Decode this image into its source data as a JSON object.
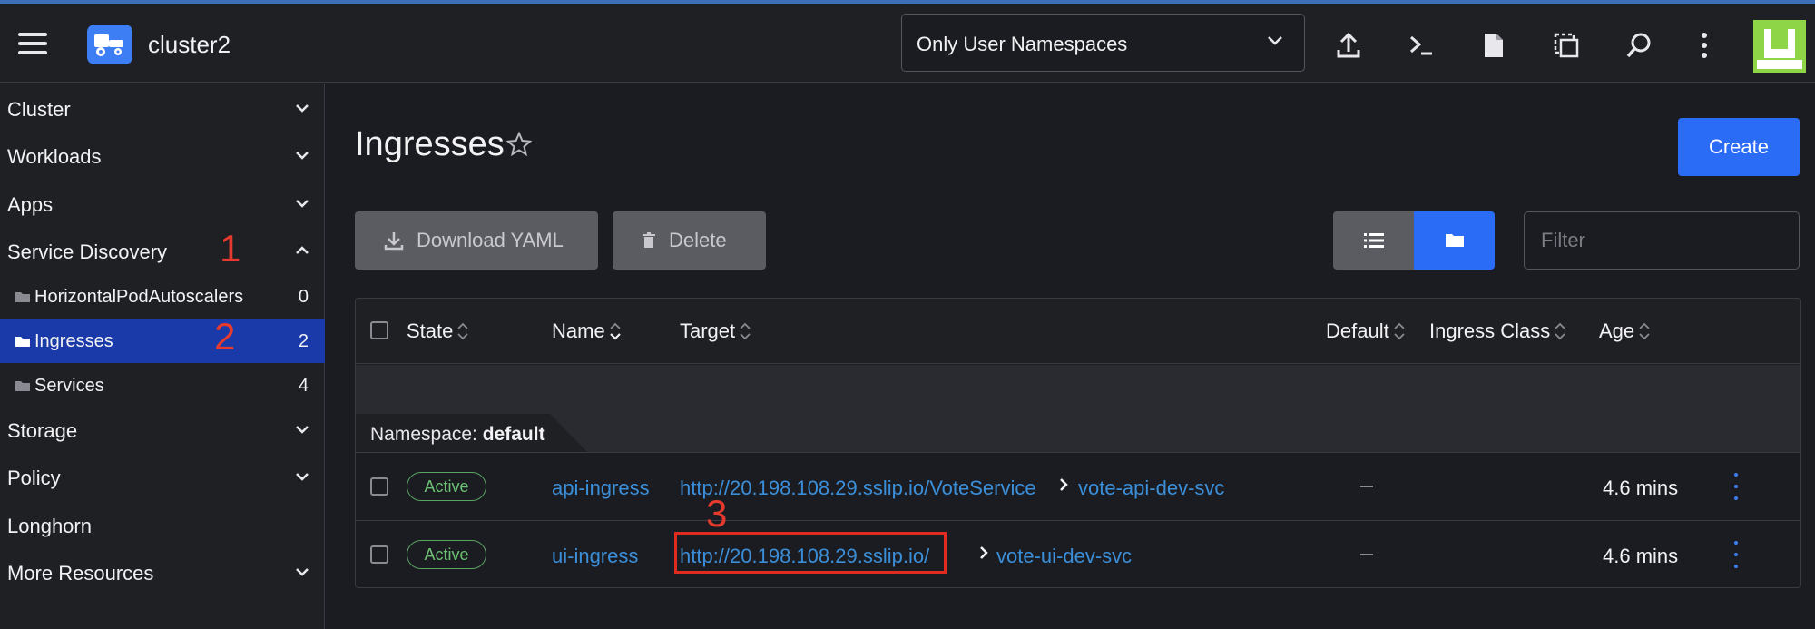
{
  "header": {
    "cluster_name": "cluster2",
    "namespace_filter": "Only User Namespaces",
    "icons": [
      "upload-icon",
      "terminal-icon",
      "file-icon",
      "copy-config-icon",
      "search-icon",
      "more-vertical-icon"
    ]
  },
  "sidebar": {
    "groups": [
      {
        "label": "Cluster"
      },
      {
        "label": "Workloads"
      },
      {
        "label": "Apps"
      },
      {
        "label": "Service Discovery"
      },
      {
        "label": "Storage"
      },
      {
        "label": "Policy"
      },
      {
        "label": "Longhorn"
      },
      {
        "label": "More Resources"
      }
    ],
    "items": [
      {
        "label": "HorizontalPodAutoscalers",
        "count": "0"
      },
      {
        "label": "Ingresses",
        "count": "2"
      },
      {
        "label": "Services",
        "count": "4"
      }
    ]
  },
  "annotations": {
    "one": "1",
    "two": "2",
    "three": "3"
  },
  "main": {
    "title": "Ingresses",
    "create_label": "Create",
    "download_label": "Download YAML",
    "delete_label": "Delete",
    "filter_placeholder": "Filter"
  },
  "table": {
    "columns": [
      "State",
      "Name",
      "Target",
      "Default",
      "Ingress Class",
      "Age"
    ],
    "group_prefix": "Namespace:",
    "group_name": "default",
    "rows": [
      {
        "state": "Active",
        "name": "api-ingress",
        "target_url": "http://20.198.108.29.sslip.io/VoteService",
        "target_svc": "vote-api-dev-svc",
        "age": "4.6 mins"
      },
      {
        "state": "Active",
        "name": "ui-ingress",
        "target_url": "http://20.198.108.29.sslip.io/",
        "target_svc": "vote-ui-dev-svc",
        "age": "4.6 mins"
      }
    ]
  },
  "colors": {
    "accent": "#2b6cf6",
    "active_nav": "#1a3aa9",
    "link": "#3b8ed8",
    "annotation": "#e63a2e"
  }
}
